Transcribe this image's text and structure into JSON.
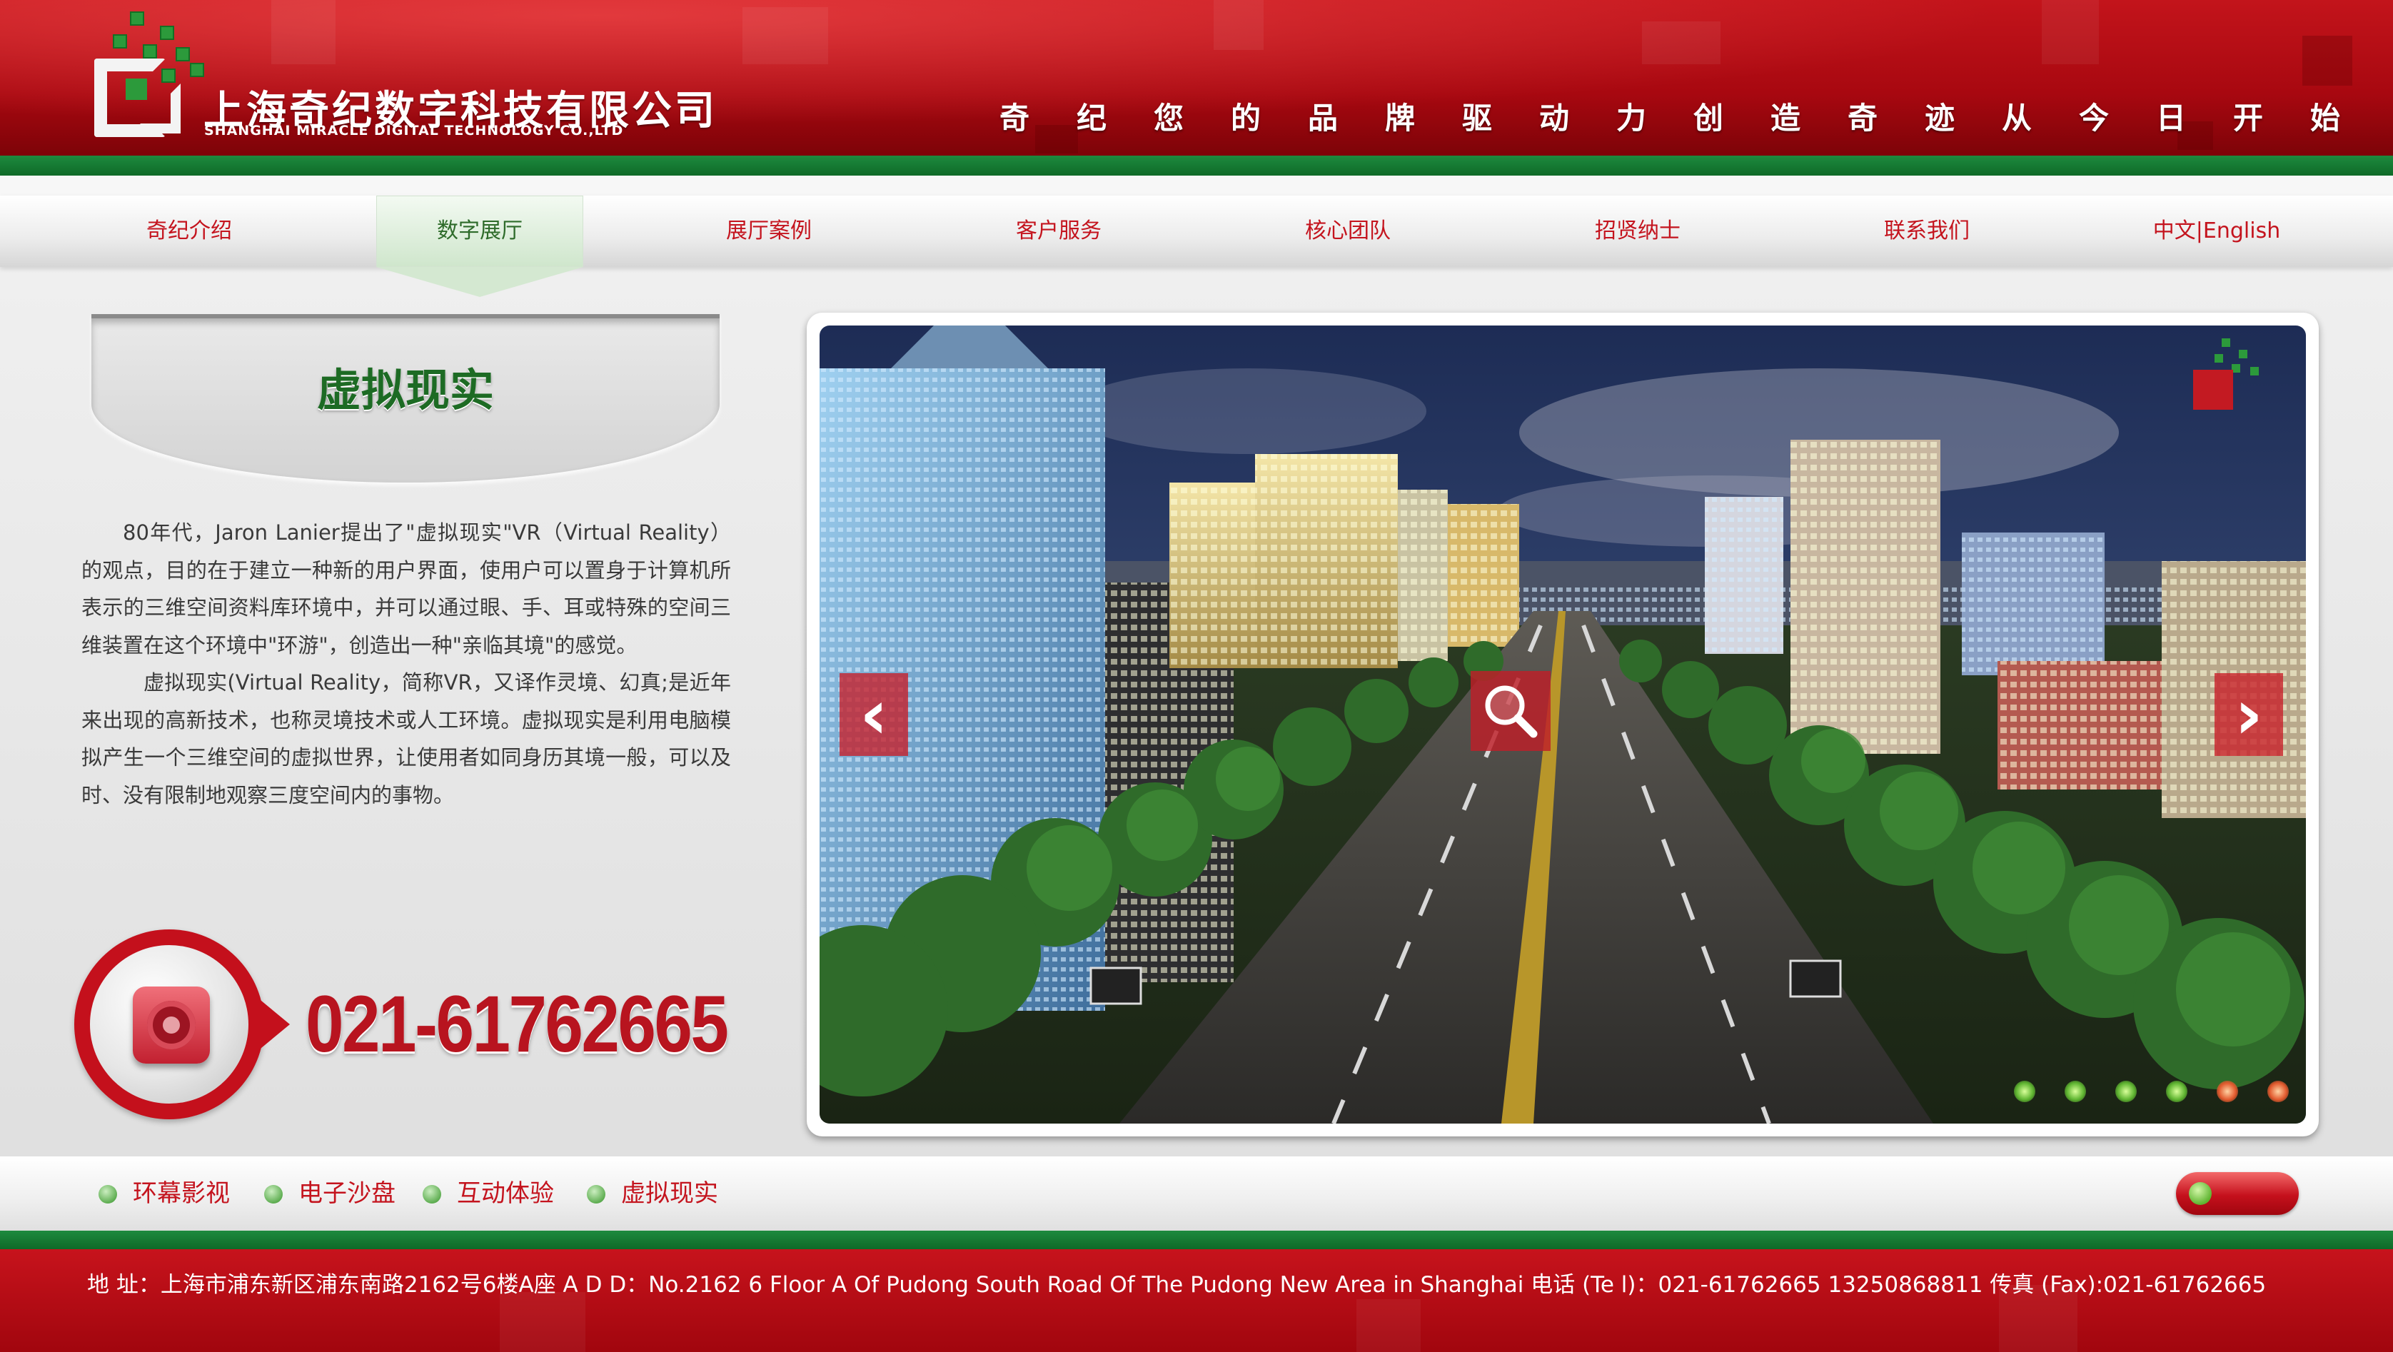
{
  "header": {
    "company_cn": "上海奇纪数字科技有限公司",
    "company_en": "SHANGHAI MIRACLE DIGITAL TECHNOLOGY CO.,LTD",
    "slogan": "奇纪您的品牌驱动力创造奇迹从今日开始"
  },
  "nav": {
    "items": [
      {
        "label": "奇纪介绍"
      },
      {
        "label": "数字展厅",
        "active": true
      },
      {
        "label": "展厅案例"
      },
      {
        "label": "客户服务"
      },
      {
        "label": "核心团队"
      },
      {
        "label": "招贤纳士"
      },
      {
        "label": "联系我们"
      },
      {
        "label": "中文|English"
      }
    ]
  },
  "sidebar": {
    "title": "虚拟现实",
    "paragraphs": [
      "80年代，Jaron Lanier提出了\"虚拟现实\"VR（Virtual Reality）的观点，目的在于建立一种新的用户界面，使用户可以置身于计算机所表示的三维空间资料库环境中，并可以通过眼、手、耳或特殊的空间三维装置在这个环境中\"环游\"，创造出一种\"亲临其境\"的感觉。",
      "虚拟现实(Virtual Reality，简称VR，又译作灵境、幻真;是近年来出现的高新技术，也称灵境技术或人工环境。虚拟现实是利用电脑模拟产生一个三维空间的虚拟世界，让使用者如同身历其境一般，可以及时、没有限制地观察三度空间内的事物。"
    ],
    "phone": "021-61762665"
  },
  "gallery": {
    "prev_icon": "chevron-left-icon",
    "next_icon": "chevron-right-icon",
    "zoom_icon": "magnifier-icon",
    "prev_glyph": "‹",
    "next_glyph": "›",
    "indicators": [
      "green",
      "green",
      "green",
      "green",
      "red",
      "red"
    ]
  },
  "categories": [
    {
      "label": "环幕影视"
    },
    {
      "label": "电子沙盘"
    },
    {
      "label": "互动体验"
    },
    {
      "label": "虚拟现实"
    }
  ],
  "footer": {
    "address": "地    址：上海市浦东新区浦东南路2162号6楼A座   A   D   D：No.2162 6 Floor A Of Pudong South Road Of The Pudong New Area in Shanghai  电话 (Te l)：021-61762665 13250868811  传真 (Fax):021-61762665"
  },
  "colors": {
    "brand_red": "#c4141e",
    "brand_green": "#1d8a3e",
    "active_nav": "#cfe6cc"
  }
}
